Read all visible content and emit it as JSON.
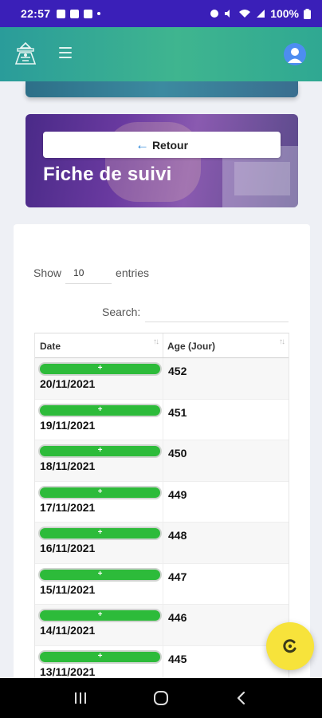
{
  "status_bar": {
    "time": "22:57",
    "battery": "100%",
    "icons": [
      "gallery-icon",
      "facebook-icon",
      "facebook-icon",
      "dot-icon",
      "alarm-icon",
      "mute-icon",
      "wifi-icon",
      "signal-icon",
      "battery-icon"
    ]
  },
  "header": {
    "logo_icon": "school-logo-icon",
    "menu_icon": "hamburger-icon",
    "user_icon": "user-avatar-icon",
    "accent_color": "#2a9c9a"
  },
  "hero": {
    "back_label": "Retour",
    "back_icon": "arrow-left-icon",
    "title": "Fiche de suivi"
  },
  "table_controls": {
    "show_label": "Show",
    "entries_value": "10",
    "entries_label": "entries",
    "search_label": "Search:",
    "search_value": ""
  },
  "table": {
    "columns": [
      "Date",
      "Age (Jour)"
    ],
    "action_label": "+",
    "rows": [
      {
        "date": "20/11/2021",
        "age": "452"
      },
      {
        "date": "19/11/2021",
        "age": "451"
      },
      {
        "date": "18/11/2021",
        "age": "450"
      },
      {
        "date": "17/11/2021",
        "age": "449"
      },
      {
        "date": "16/11/2021",
        "age": "448"
      },
      {
        "date": "15/11/2021",
        "age": "447"
      },
      {
        "date": "14/11/2021",
        "age": "446"
      },
      {
        "date": "13/11/2021",
        "age": "445"
      }
    ],
    "action_color": "#2dbb3a"
  },
  "fab": {
    "icon": "refresh-icon",
    "color": "#f7e33b"
  },
  "nav": {
    "buttons": [
      "recent-apps-icon",
      "home-icon",
      "back-icon"
    ]
  }
}
